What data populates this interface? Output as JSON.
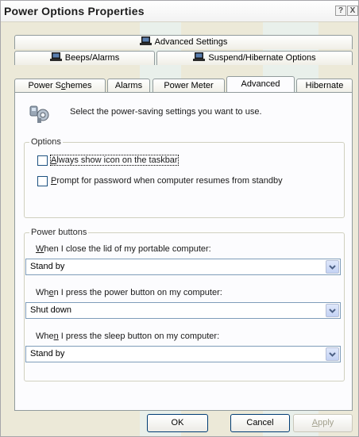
{
  "window": {
    "title": "Power Options Properties",
    "help_button": "?",
    "close_button": "X"
  },
  "tabs": {
    "row1": [
      {
        "label": "Advanced Settings",
        "icon": "laptop-icon"
      }
    ],
    "row2": [
      {
        "label": "Beeps/Alarms",
        "icon": "laptop-icon"
      },
      {
        "label": "Suspend/Hibernate Options",
        "icon": "laptop-icon"
      }
    ],
    "row3": [
      {
        "label_pre": "Power S",
        "label_ul": "c",
        "label_post": "hemes"
      },
      {
        "label": "Alarms"
      },
      {
        "label": "Power Meter"
      },
      {
        "label": "Advanced",
        "active": true
      },
      {
        "label": "Hibernate"
      }
    ]
  },
  "intro": {
    "icon": "power-settings-icon",
    "text": "Select the power-saving settings you want to use."
  },
  "options": {
    "legend": "Options",
    "show_icon": {
      "ul": "A",
      "rest": "lways show icon on the taskbar",
      "checked": false
    },
    "prompt_password": {
      "ul": "P",
      "rest": "rompt for password when computer resumes from standby",
      "checked": false
    }
  },
  "power_buttons": {
    "legend": "Power buttons",
    "lid": {
      "ul": "W",
      "rest": "hen I close the lid of my portable computer:",
      "value": "Stand by"
    },
    "power": {
      "pre": "Wh",
      "ul": "e",
      "rest": "n I press the power button on my computer:",
      "value": "Shut down"
    },
    "sleep": {
      "pre": "Whe",
      "ul": "n",
      "rest": " I press the sleep button on my computer:",
      "value": "Stand by"
    }
  },
  "buttons": {
    "ok": "OK",
    "cancel": "Cancel",
    "apply_ul": "A",
    "apply_rest": "pply"
  },
  "colors": {
    "dialog_bg": "#ece9d8",
    "panel_bg": "#fcfcfe",
    "combo_border": "#7f9db9",
    "button_border": "#003c74"
  }
}
